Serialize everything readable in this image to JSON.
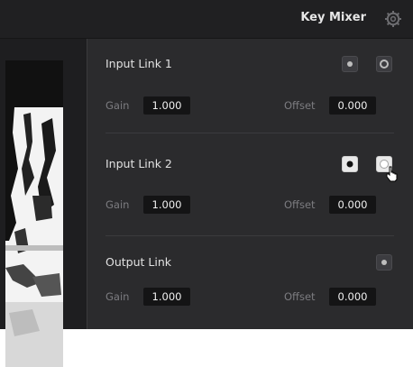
{
  "header": {
    "title": "Key Mixer",
    "settings_icon": "gear-icon"
  },
  "sections": [
    {
      "title": "Input Link 1",
      "gain_label": "Gain",
      "gain_value": "1.000",
      "offset_label": "Offset",
      "offset_value": "0.000",
      "buttons": [
        "dark",
        "dark"
      ]
    },
    {
      "title": "Input Link 2",
      "gain_label": "Gain",
      "gain_value": "1.000",
      "offset_label": "Offset",
      "offset_value": "0.000",
      "buttons": [
        "light",
        "light"
      ]
    },
    {
      "title": "Output Link",
      "gain_label": "Gain",
      "gain_value": "1.000",
      "offset_label": "Offset",
      "offset_value": "0.000",
      "buttons": [
        "dark"
      ]
    }
  ]
}
